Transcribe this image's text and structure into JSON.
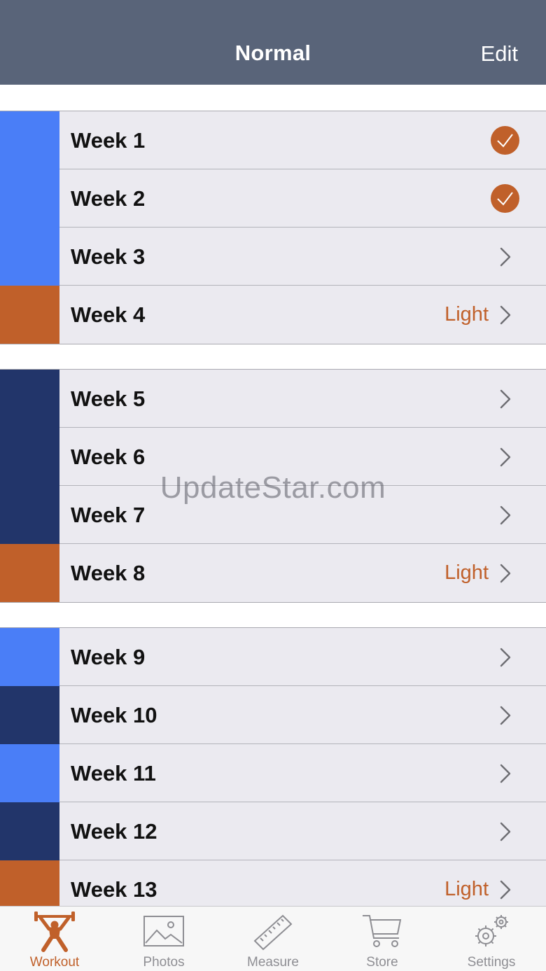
{
  "navbar": {
    "title": "Normal",
    "edit_label": "Edit"
  },
  "colors": {
    "accent": "#c0602a",
    "light_blue": "#4a7ef7",
    "dark_blue": "#22356a",
    "orange": "#c0602a",
    "navbar": "#596479",
    "row_bg": "#ebeaf0"
  },
  "groups": [
    {
      "rows": [
        {
          "label": "Week 1",
          "color": "#4a7ef7",
          "status": "completed",
          "icon": "checkmark-icon"
        },
        {
          "label": "Week 2",
          "color": "#4a7ef7",
          "status": "completed",
          "icon": "checkmark-icon"
        },
        {
          "label": "Week 3",
          "color": "#4a7ef7",
          "status": "pending",
          "icon": "chevron-right-icon"
        },
        {
          "label": "Week 4",
          "color": "#c0602a",
          "status": "pending",
          "detail": "Light",
          "icon": "chevron-right-icon"
        }
      ]
    },
    {
      "rows": [
        {
          "label": "Week 5",
          "color": "#22356a",
          "status": "pending",
          "icon": "chevron-right-icon"
        },
        {
          "label": "Week 6",
          "color": "#22356a",
          "status": "pending",
          "icon": "chevron-right-icon"
        },
        {
          "label": "Week 7",
          "color": "#22356a",
          "status": "pending",
          "icon": "chevron-right-icon"
        },
        {
          "label": "Week 8",
          "color": "#c0602a",
          "status": "pending",
          "detail": "Light",
          "icon": "chevron-right-icon"
        }
      ]
    },
    {
      "rows": [
        {
          "label": "Week 9",
          "color": "#4a7ef7",
          "status": "pending",
          "icon": "chevron-right-icon"
        },
        {
          "label": "Week 10",
          "color": "#22356a",
          "status": "pending",
          "icon": "chevron-right-icon"
        },
        {
          "label": "Week 11",
          "color": "#4a7ef7",
          "status": "pending",
          "icon": "chevron-right-icon"
        },
        {
          "label": "Week 12",
          "color": "#22356a",
          "status": "pending",
          "icon": "chevron-right-icon"
        },
        {
          "label": "Week 13",
          "color": "#c0602a",
          "status": "pending",
          "detail": "Light",
          "icon": "chevron-right-icon"
        }
      ]
    }
  ],
  "watermark": "UpdateStar.com",
  "tabbar": {
    "tabs": [
      {
        "label": "Workout",
        "icon": "weightlifter-icon",
        "active": true
      },
      {
        "label": "Photos",
        "icon": "photo-icon",
        "active": false
      },
      {
        "label": "Measure",
        "icon": "ruler-icon",
        "active": false
      },
      {
        "label": "Store",
        "icon": "cart-icon",
        "active": false
      },
      {
        "label": "Settings",
        "icon": "gears-icon",
        "active": false
      }
    ]
  }
}
